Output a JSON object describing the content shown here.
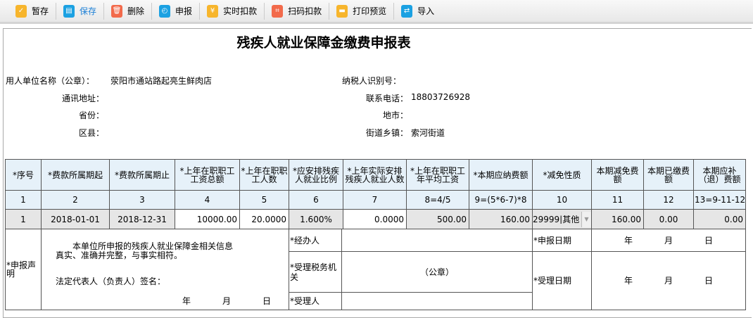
{
  "toolbar": [
    {
      "label": "暂存",
      "icon": "draft-icon",
      "color": "#f7b52c"
    },
    {
      "label": "保存",
      "icon": "save-icon",
      "color": "#1ba1e2"
    },
    {
      "label": "删除",
      "icon": "delete-icon",
      "color": "#f26a4b"
    },
    {
      "label": "申报",
      "icon": "declare-icon",
      "color": "#1ba1e2"
    },
    {
      "label": "实时扣款",
      "icon": "realtime-deduct-icon",
      "color": "#f7b52c"
    },
    {
      "label": "扫码扣款",
      "icon": "scan-deduct-icon",
      "color": "#f26a4b"
    },
    {
      "label": "打印预览",
      "icon": "print-icon",
      "color": "#f7b52c"
    },
    {
      "label": "导入",
      "icon": "import-icon",
      "color": "#1ba1e2"
    }
  ],
  "title": "残疾人就业保障金缴费申报表",
  "info": {
    "unit_label": "用人单位名称（公章）：",
    "unit_value": "荥阳市通站路起亮生鲜肉店",
    "taxid_label": "纳税人识别号：",
    "taxid_value": "",
    "address_label": "通讯地址：",
    "phone_label": "联系电话：",
    "phone_value": "18803726928",
    "province_label": "省份：",
    "city_label": "地市：",
    "county_label": "区县：",
    "street_label": "街道乡镇：",
    "street_value": "索河街道"
  },
  "table": {
    "headers": [
      "*序号",
      "*费款所属期起",
      "*费款所属期止",
      "*上年在职职工工资总额",
      "*上年在职职工人数",
      "*应安排残疾人就业比例",
      "*上年实际安排残疾人就业人数",
      "*上年在职职工年平均工资",
      "*本期应纳费额",
      "*减免性质",
      "本期减免费额",
      "本期已缴费额",
      "本期应补（退）费额"
    ],
    "numbers": [
      "1",
      "2",
      "3",
      "4",
      "5",
      "6",
      "7",
      "8=4/5",
      "9=(5*6-7)*8",
      "10",
      "11",
      "12",
      "13=9-11-12"
    ],
    "row": [
      "1",
      "2018-01-01",
      "2018-12-31",
      "10000.00",
      "20.0000",
      "1.600%",
      "0.0000",
      "500.00",
      "160.00",
      "29999|其他",
      "160.00",
      "0.00",
      "0.00"
    ]
  },
  "declaration": {
    "label": "*申报声明",
    "text": "本单位所申报的残疾人就业保障金相关信息真实、准确并完整，与事实相符。",
    "legal_rep": "法定代表人（负责人）签名：",
    "year": "年",
    "month": "月",
    "day": "日",
    "handler": "*经办人",
    "tax_office": "*受理税务机关",
    "seal": "（公章）",
    "receiver": "*受理人",
    "declare_date": "*申报日期",
    "accept_date": "*受理日期"
  }
}
